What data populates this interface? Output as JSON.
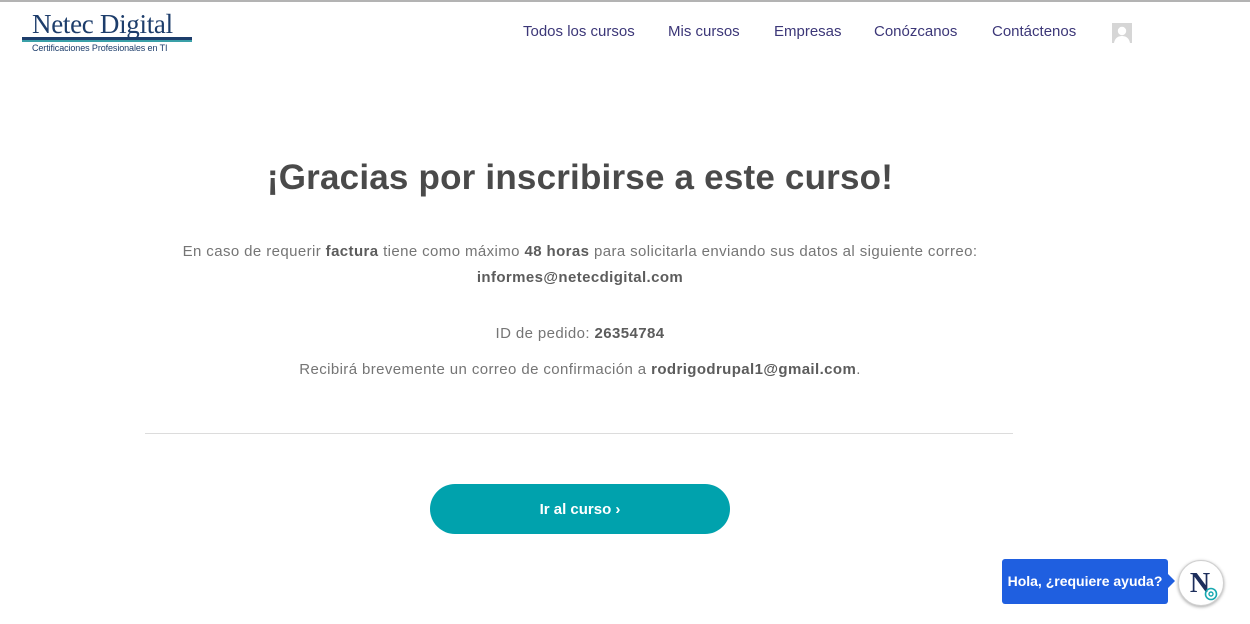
{
  "logo": {
    "brand": "Netec Digital",
    "tagline": "Certificaciones Profesionales en TI"
  },
  "nav": {
    "items": [
      {
        "label": "Todos los cursos"
      },
      {
        "label": "Mis cursos"
      },
      {
        "label": "Empresas"
      },
      {
        "label": "Conózcanos"
      },
      {
        "label": "Contáctenos"
      }
    ],
    "avatar_icon": "user-avatar-icon"
  },
  "main": {
    "title": "¡Gracias por inscribirse a este curso!",
    "invoice": {
      "prefix": "En caso de requerir ",
      "keyword": "factura",
      "middle": " tiene como máximo ",
      "hours": "48 horas",
      "suffix": " para solicitarla enviando sus datos al siguiente correo:",
      "email": "informes@netecdigital.com"
    },
    "order": {
      "label": "ID de pedido: ",
      "id": "26354784"
    },
    "confirmation": {
      "prefix": "Recibirá brevemente un correo de confirmación a ",
      "email": "rodrigodrupal1@gmail.com",
      "suffix": "."
    },
    "cta_label": "Ir al curso ›"
  },
  "chat": {
    "bubble_text": "Hola, ¿requiere ayuda?",
    "avatar_icon": "netec-chat-icon"
  },
  "colors": {
    "nav_text": "#3c3778",
    "brand_navy": "#1d3d6b",
    "cta_teal": "#00a2ad",
    "chat_blue": "#1f5fe0"
  }
}
